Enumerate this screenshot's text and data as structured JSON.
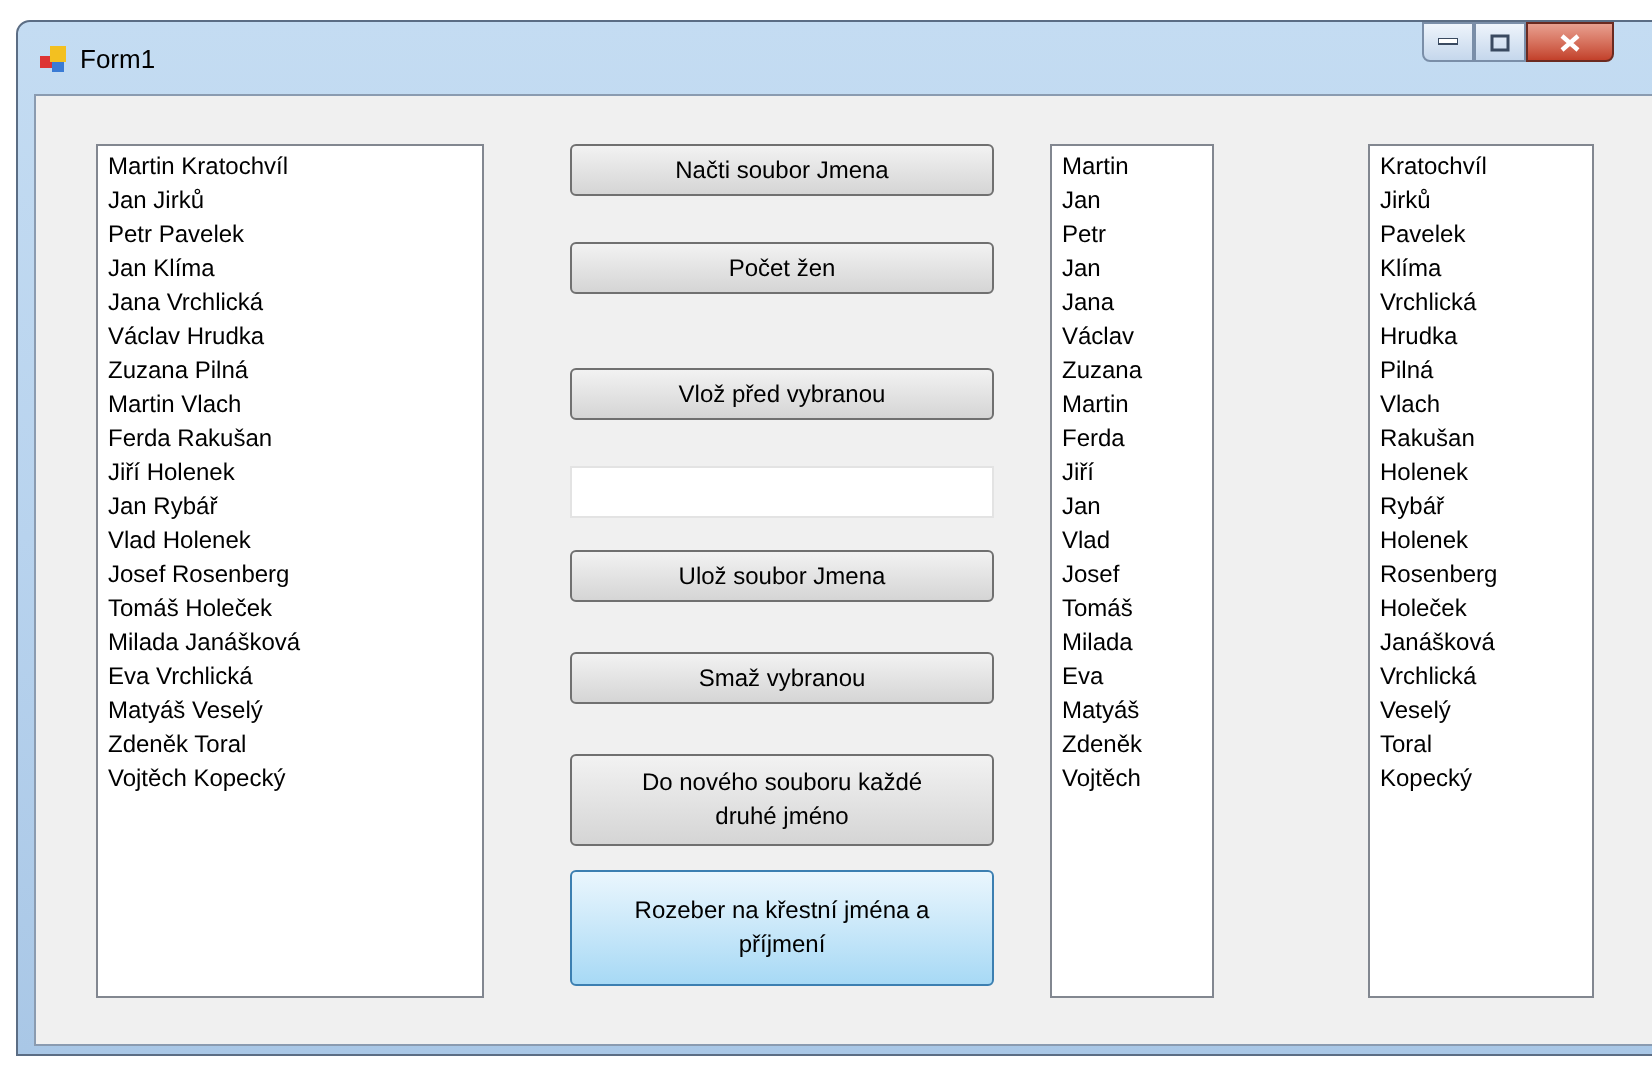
{
  "window": {
    "title": "Form1"
  },
  "title_buttons": [
    {
      "kind": "minimize"
    },
    {
      "kind": "maximize"
    },
    {
      "kind": "close"
    }
  ],
  "full_names": [
    "Martin Kratochvíl",
    "Jan Jirků",
    "Petr Pavelek",
    "Jan Klíma",
    "Jana Vrchlická",
    "Václav Hrudka",
    "Zuzana Pilná",
    "Martin Vlach",
    "Ferda Rakušan",
    "Jiří Holenek",
    "Jan Rybář",
    "Vlad Holenek",
    "Josef Rosenberg",
    "Tomáš Holeček",
    "Milada Janášková",
    "Eva Vrchlická",
    "Matyáš Veselý",
    "Zdeněk Toral",
    "Vojtěch Kopecký"
  ],
  "controls": [
    {
      "kind": "button",
      "label": "Načti soubor Jmena",
      "highlighted": false
    },
    {
      "kind": "button",
      "label": "Počet žen",
      "highlighted": false
    },
    {
      "kind": "button",
      "label": "Vlož před vybranou",
      "highlighted": false
    },
    {
      "kind": "textbox"
    },
    {
      "kind": "button",
      "label": "Ulož soubor Jmena",
      "highlighted": false
    },
    {
      "kind": "button",
      "label": "Smaž vybranou",
      "highlighted": false
    },
    {
      "kind": "button",
      "label": "Do nového souboru každé druhé jméno",
      "highlighted": false
    },
    {
      "kind": "button",
      "label": "Rozeber na křestní jména a příjmení",
      "highlighted": true
    }
  ],
  "first_names": [
    "Martin",
    "Jan",
    "Petr",
    "Jan",
    "Jana",
    "Václav",
    "Zuzana",
    "Martin",
    "Ferda",
    "Jiří",
    "Jan",
    "Vlad",
    "Josef",
    "Tomáš",
    "Milada",
    "Eva",
    "Matyáš",
    "Zdeněk",
    "Vojtěch"
  ],
  "surnames": [
    "Kratochvíl",
    "Jirků",
    "Pavelek",
    "Klíma",
    "Vrchlická",
    "Hrudka",
    "Pilná",
    "Vlach",
    "Rakušan",
    "Holenek",
    "Rybář",
    "Holenek",
    "Rosenberg",
    "Holeček",
    "Janášková",
    "Vrchlická",
    "Veselý",
    "Toral",
    "Kopecký"
  ]
}
